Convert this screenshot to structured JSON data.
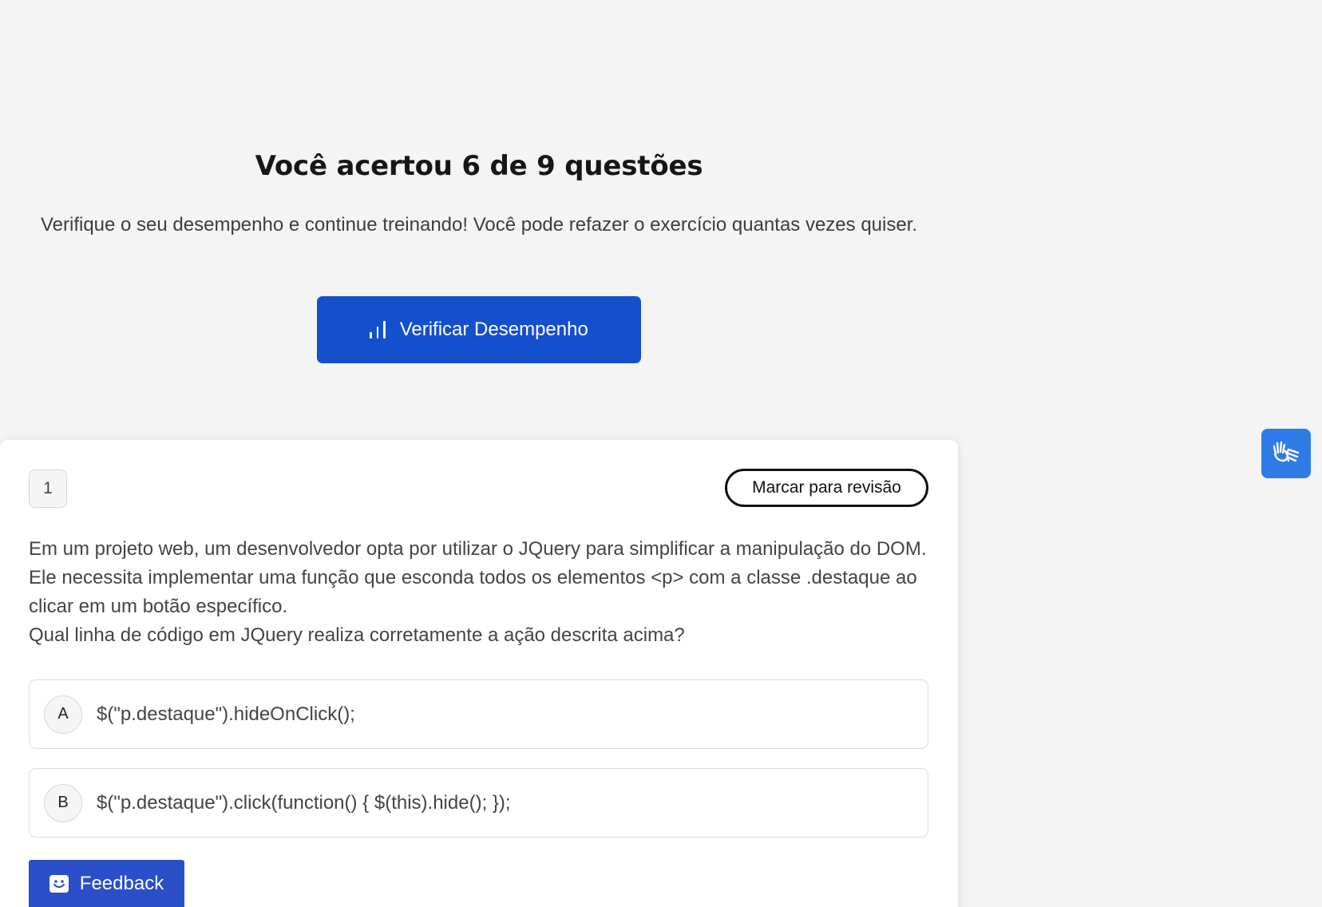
{
  "results": {
    "title": "Você acertou 6 de 9 questões",
    "subtitle": "Verifique o seu desempenho e continue treinando! Você pode refazer o exercício quantas vezes quiser.",
    "performance_button_label": "Verificar Desempenho",
    "performance_button_icon": "bar-chart-icon",
    "accent_color": "#144fce"
  },
  "question": {
    "number": "1",
    "review_button_label": "Marcar para revisão",
    "text_lines": [
      "Em um projeto web, um desenvolvedor opta por utilizar o JQuery para simplificar a manipulação do DOM. Ele necessita implementar uma função que esconda todos os elementos <p> com a classe .destaque ao clicar em um botão específico.",
      "Qual linha de código em JQuery realiza corretamente a ação descrita acima?"
    ],
    "options": [
      {
        "letter": "A",
        "text": "$(\"p.destaque\").hideOnClick();"
      },
      {
        "letter": "B",
        "text": "$(\"p.destaque\").click(function() { $(this).hide(); });"
      }
    ]
  },
  "feedback": {
    "label": "Feedback",
    "icon": "smiley-icon",
    "color": "#2a4fc9"
  },
  "accessibility": {
    "icon": "sign-language-hands-icon",
    "color": "#2f7be8"
  }
}
